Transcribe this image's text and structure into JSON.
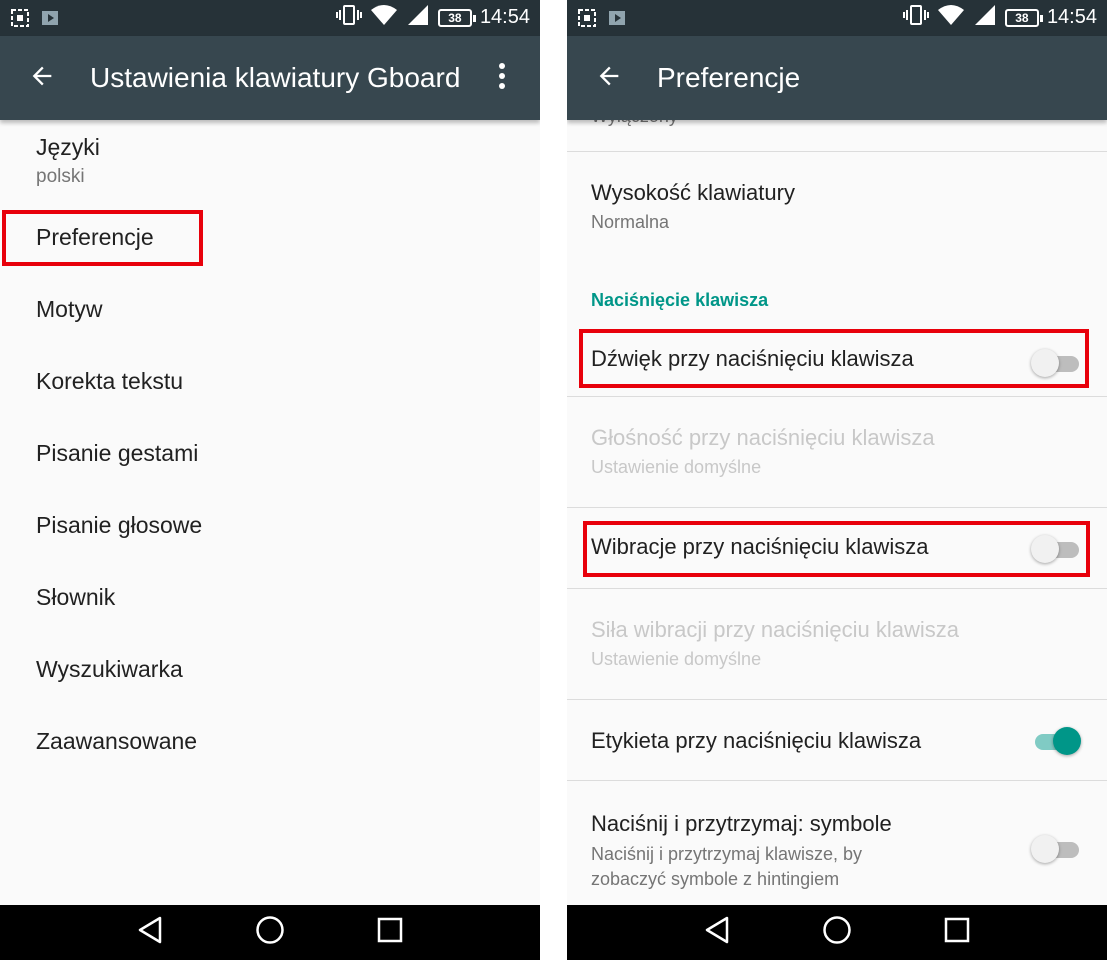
{
  "status_bar": {
    "time": "14:54",
    "battery": "38"
  },
  "left_screen": {
    "title": "Ustawienia klawiatury Gboard",
    "items": [
      {
        "label": "Języki",
        "sub": "polski"
      },
      {
        "label": "Preferencje"
      },
      {
        "label": "Motyw"
      },
      {
        "label": "Korekta tekstu"
      },
      {
        "label": "Pisanie gestami"
      },
      {
        "label": "Pisanie głosowe"
      },
      {
        "label": "Słownik"
      },
      {
        "label": "Wyszukiwarka"
      },
      {
        "label": "Zaawansowane"
      }
    ]
  },
  "right_screen": {
    "title": "Preferencje",
    "partial_item_sub": "Wyłączony",
    "keyboard_height": {
      "title": "Wysokość klawiatury",
      "sub": "Normalna"
    },
    "section_header": "Naciśnięcie klawisza",
    "sound": {
      "title": "Dźwięk przy naciśnięciu klawisza",
      "on": false
    },
    "volume": {
      "title": "Głośność przy naciśnięciu klawisza",
      "sub": "Ustawienie domyślne"
    },
    "vibration": {
      "title": "Wibracje przy naciśnięciu klawisza",
      "on": false
    },
    "vibration_strength": {
      "title": "Siła wibracji przy naciśnięciu klawisza",
      "sub": "Ustawienie domyślne"
    },
    "popup": {
      "title": "Etykieta przy naciśnięciu klawisza",
      "on": true
    },
    "long_press": {
      "title": "Naciśnij i przytrzymaj: symbole",
      "sub_line1": "Naciśnij i przytrzymaj klawisze, by",
      "sub_line2": "zobaczyć symbole z hintingiem",
      "on": false
    }
  },
  "colors": {
    "status_bar": "#263238",
    "toolbar": "#37474f",
    "accent": "#009688",
    "highlight": "#e8000b"
  },
  "icons": [
    "screenshot-icon",
    "play-store-icon",
    "vibrate-icon",
    "wifi-icon",
    "signal-icon",
    "battery-icon",
    "back-arrow-icon",
    "more-vert-icon",
    "nav-back-icon",
    "nav-home-icon",
    "nav-recents-icon"
  ]
}
